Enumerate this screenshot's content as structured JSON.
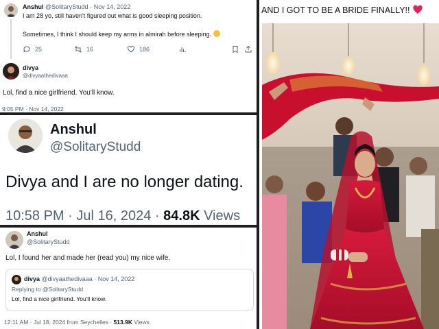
{
  "tweet1": {
    "name": "Anshul",
    "handle": "@SolitaryStudd",
    "date": "Nov 14, 2022",
    "line1": "I am 28 yo, still haven't figured out what is good sleeping position.",
    "line2": "Sometimes, I think I should keep my arms in almirah before sleeping.",
    "replies": "25",
    "retweets": "16",
    "likes": "186"
  },
  "reply1": {
    "name": "divya",
    "handle": "@divyaathedivaaa",
    "text": "Lol, find a nice girlfriend. You'll know.",
    "timestamp": "9:05 PM · Nov 14, 2022"
  },
  "tweet2": {
    "name": "Anshul",
    "handle": "@SolitaryStudd",
    "text": "Divya and I are no longer dating.",
    "time_date": "10:58 PM · Jul 16, 2024 ·",
    "views_count": "84.8K",
    "views_label": "Views"
  },
  "tweet3": {
    "name": "Anshul",
    "handle": "@SolitaryStudd",
    "text": "Lol, I found her and made her (read you) my nice wife.",
    "quote": {
      "name": "divya",
      "handle": "@divyaathedivaaa · Nov 14, 2022",
      "replying_to_prefix": "Replying to",
      "replying_to": "@SolitaryStudd",
      "text": "Lol, find a nice girlfriend. You'll know."
    },
    "footer": "12:11 AM · Jul 18, 2024 from Seychelles ·",
    "views_count": "513.9K",
    "views_label": "Views"
  },
  "bride_post": {
    "caption": "AND I GOT TO BE A BRIDE FINALLY!!"
  },
  "colors": {
    "accent_blue": "#1d9bf0",
    "muted": "#536471",
    "heart": "#e0245e",
    "lehenga_red": "#c8102e"
  }
}
